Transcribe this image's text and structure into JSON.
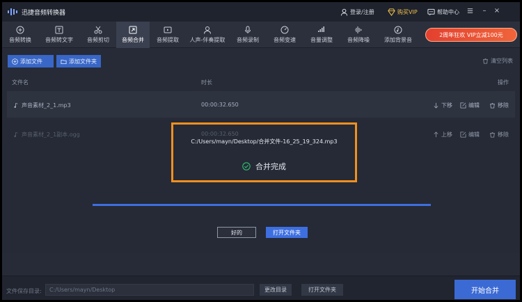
{
  "app": {
    "title": "迅捷音频转换器"
  },
  "titlebar": {
    "login_label": "登录/注册",
    "buy_vip_label": "购买VIP",
    "help_label": "帮助中心",
    "menu_icon": "menu-icon",
    "minimize_glyph": "–",
    "close_glyph": "×"
  },
  "toolbar": {
    "tools": [
      {
        "label": "音频转换",
        "icon": "convert-icon"
      },
      {
        "label": "音频转文字",
        "icon": "text-icon"
      },
      {
        "label": "音频剪切",
        "icon": "scissors-icon"
      },
      {
        "label": "音频合并",
        "icon": "merge-icon"
      },
      {
        "label": "音频提取",
        "icon": "extract-icon"
      },
      {
        "label": "人声-伴奏提取",
        "icon": "voice-icon"
      },
      {
        "label": "音频录制",
        "icon": "mic-icon"
      },
      {
        "label": "音频变速",
        "icon": "speed-icon"
      },
      {
        "label": "音量调整",
        "icon": "volume-icon"
      },
      {
        "label": "音频降噪",
        "icon": "denoise-icon"
      },
      {
        "label": "添加背景音",
        "icon": "music-icon"
      }
    ],
    "active_index": 3,
    "promo_label": "2周年狂欢 VIP立减100元"
  },
  "actions": {
    "add_file_label": "添加文件",
    "add_folder_label": "添加文件夹",
    "clear_list_label": "清空列表"
  },
  "table": {
    "headers": {
      "filename": "文件名",
      "duration": "时长",
      "operation": "操作"
    },
    "rows": [
      {
        "name": "声音素材_2_1.mp3",
        "duration": "00:00:32.650",
        "move_label": "下移",
        "edit_label": "编辑",
        "remove_label": "移除"
      },
      {
        "name": "声音素材_2_1副本.ogg",
        "duration": "00:00:32.650",
        "move_label": "上移",
        "edit_label": "编辑",
        "remove_label": "移除"
      }
    ]
  },
  "modal": {
    "output_path": "C:/Users/mayn/Desktop/合并文件-16_25_19_324.mp3",
    "status_label": "合并完成",
    "progress": 1.0,
    "ok_label": "好的",
    "open_folder_label": "打开文件夹"
  },
  "footer": {
    "save_dir_label": "文件保存目录:",
    "save_dir_value": "C:/Users/mayn/Desktop",
    "change_dir_label": "更改目录",
    "open_folder_label": "打开文件夹",
    "start_label": "开始合并"
  },
  "colors": {
    "accent": "#3d6fe0",
    "highlight": "#f0901e",
    "success": "#2fbf71",
    "vip": "#f2c14e",
    "promo": "#e3402f"
  }
}
